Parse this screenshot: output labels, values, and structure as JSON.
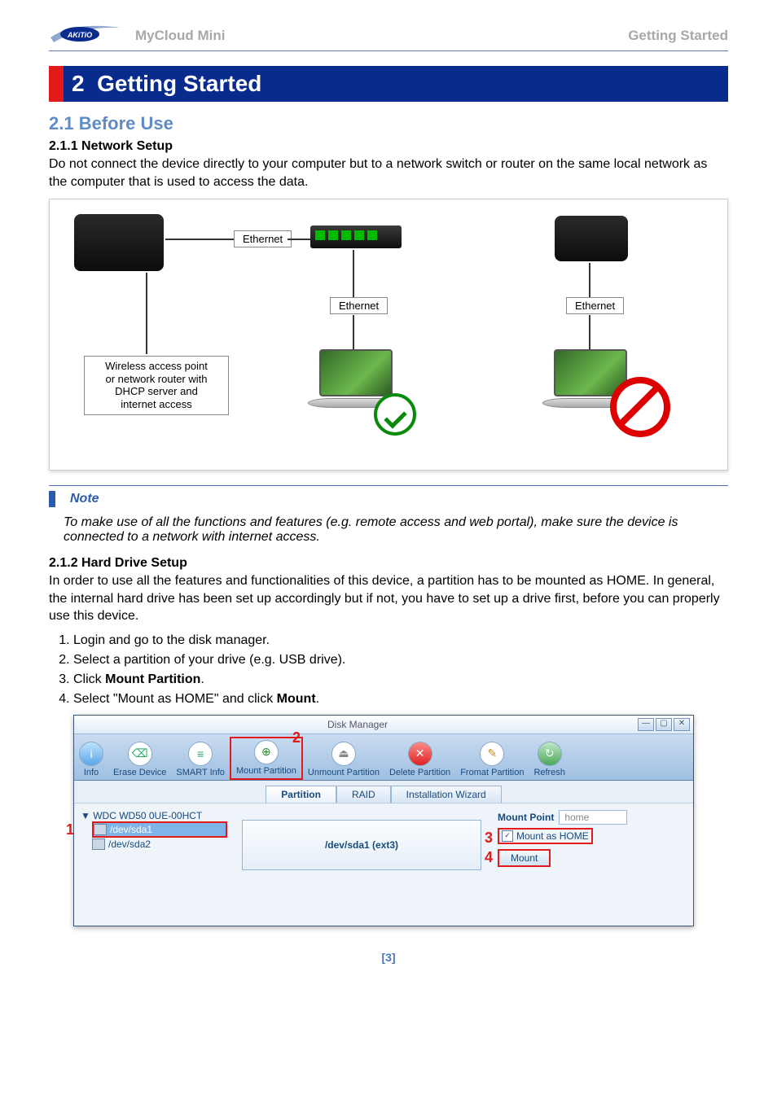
{
  "header": {
    "product": "MyCloud Mini",
    "section": "Getting Started"
  },
  "chapter": {
    "number": "2",
    "title": "Getting Started"
  },
  "s21": {
    "heading": "2.1  Before Use",
    "s211": {
      "heading": "2.1.1   Network Setup",
      "text": "Do not connect the device directly to your computer but to a network switch or router on the same local network as the computer that is used to access the data."
    },
    "diagram": {
      "eth1": "Ethernet",
      "eth2": "Ethernet",
      "eth3": "Ethernet",
      "router": "Wireless access point\nor network router with\nDHCP server and\ninternet access"
    },
    "note": {
      "label": "Note",
      "text": "To make use of all the functions and features (e.g. remote access and web portal), make sure the device is connected to a network with internet access."
    },
    "s212": {
      "heading": "2.1.2   Hard Drive Setup",
      "text": "In order to use all the features and functionalities of this device, a partition has to be mounted as HOME. In general, the internal hard drive has been set up accordingly but if not, you have to set up a drive first, before you can properly use this device.",
      "steps": [
        "Login and go to the disk manager.",
        "Select a partition of your drive (e.g. USB drive).",
        {
          "pre": "Click ",
          "bold": "Mount Partition",
          "post": "."
        },
        {
          "pre": "Select \"Mount as HOME\" and click ",
          "bold": "Mount",
          "post": "."
        }
      ]
    }
  },
  "dm": {
    "title": "Disk Manager",
    "winbtns": [
      "—",
      "▢",
      "✕"
    ],
    "toolbar": [
      "Info",
      "Erase Device",
      "SMART Info",
      "Mount Partition",
      "Unmount Partition",
      "Delete Partition",
      "Fromat Partition",
      "Refresh"
    ],
    "tabs": [
      "Partition",
      "RAID",
      "Installation Wizard"
    ],
    "tree": {
      "root": "WDC WD50 0UE-00HCT",
      "items": [
        "/dev/sda1",
        "/dev/sda2"
      ]
    },
    "partition_label": "/dev/sda1 (ext3)",
    "mount": {
      "label": "Mount Point",
      "value": "home",
      "checkbox": "Mount as HOME",
      "button": "Mount"
    },
    "highlights": {
      "n1": "1",
      "n2": "2",
      "n3": "3",
      "n4": "4"
    }
  },
  "page_number": "[3]"
}
